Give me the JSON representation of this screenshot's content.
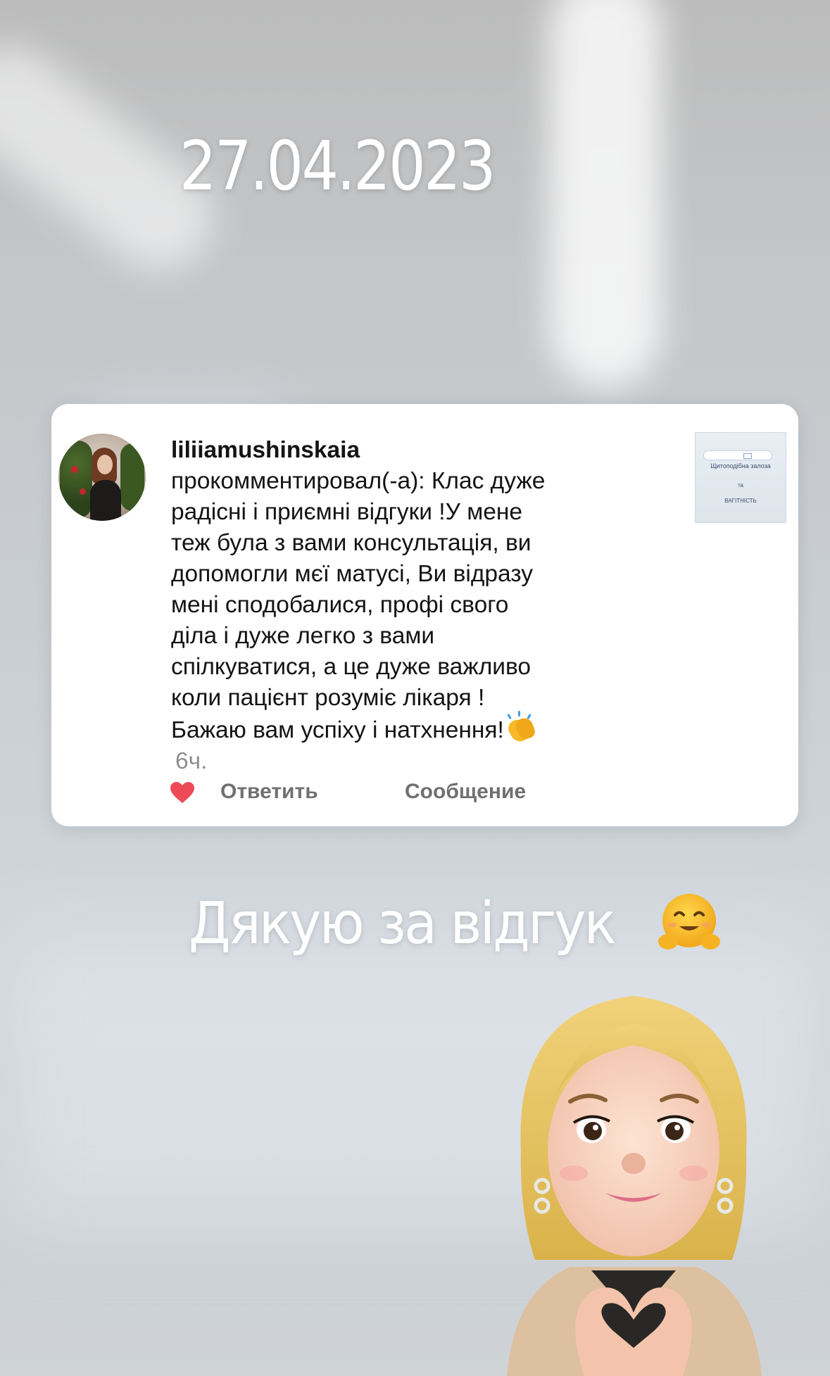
{
  "story": {
    "date": "27.04.2023",
    "caption": "Дякую за відгук"
  },
  "notification": {
    "username": "liliiamushinskaia",
    "text": "прокомментировал(-а): Клас дуже радісні і приємні відгуки !У мене теж була з вами консультація, ви допомогли мєї матусі, Ви відразу мені сподобалися, профі свого діла і дуже легко з вами спілкуватися, а це дуже важливо коли пацієнт розуміє лікаря !Бажаю вам успіху і натхнення!",
    "time": "6ч.",
    "reply_label": "Ответить",
    "message_label": "Сообщение",
    "heart_color": "#ed4956",
    "thumbnail": {
      "line1": "Щитоподібна залоза",
      "line2": "та",
      "line3": "ВАГІТНІСТЬ"
    }
  },
  "icons": {
    "heart": "heart-icon",
    "clap": "clapping-hands-emoji",
    "hug": "hugging-face-emoji",
    "sticker": "memoji-heart-hands-sticker"
  }
}
